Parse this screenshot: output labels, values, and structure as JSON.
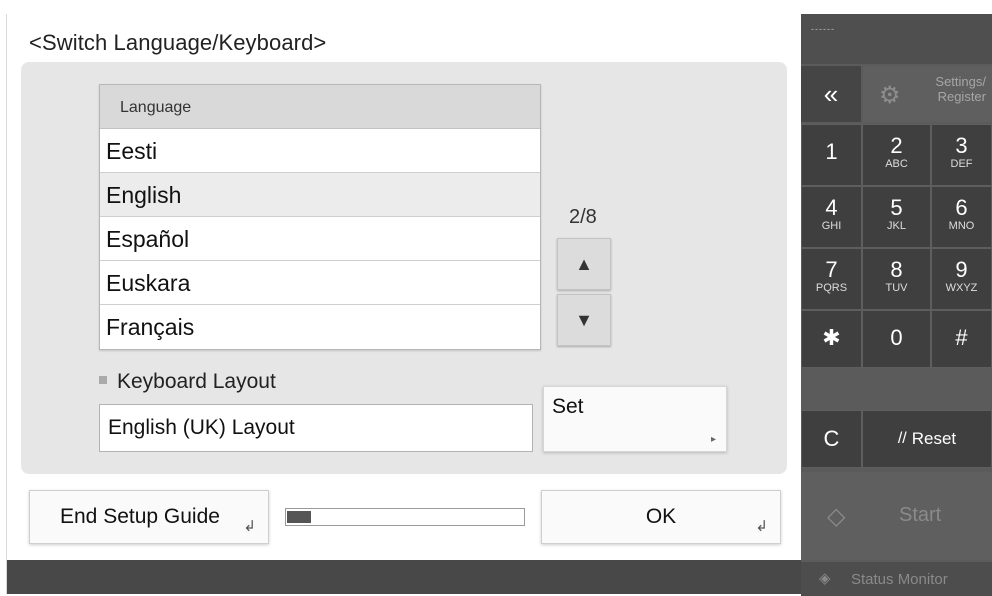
{
  "screen": {
    "title": "<Switch Language/Keyboard>"
  },
  "language_list": {
    "header": "Language",
    "items": [
      "Eesti",
      "English",
      "Español",
      "Euskara",
      "Français"
    ],
    "selected_index": 1,
    "page": "2/8"
  },
  "keyboard": {
    "label": "Keyboard Layout",
    "value": "English (UK) Layout",
    "set_label": "Set"
  },
  "footer": {
    "end_setup_label": "End Setup Guide",
    "ok_label": "OK",
    "progress_fraction": 0.1
  },
  "keypad": {
    "top_dots": "------",
    "back_glyph": "«",
    "settings_label": "Settings/ Register",
    "keys": [
      {
        "digit": "1",
        "letters": ""
      },
      {
        "digit": "2",
        "letters": "ABC"
      },
      {
        "digit": "3",
        "letters": "DEF"
      },
      {
        "digit": "4",
        "letters": "GHI"
      },
      {
        "digit": "5",
        "letters": "JKL"
      },
      {
        "digit": "6",
        "letters": "MNO"
      },
      {
        "digit": "7",
        "letters": "PQRS"
      },
      {
        "digit": "8",
        "letters": "TUV"
      },
      {
        "digit": "9",
        "letters": "WXYZ"
      },
      {
        "digit": "✱",
        "letters": ""
      },
      {
        "digit": "0",
        "letters": ""
      },
      {
        "digit": "#",
        "letters": ""
      }
    ],
    "clear_label": "C",
    "reset_label": "Reset",
    "start_label": "Start",
    "status_label": "Status Monitor"
  },
  "icons": {
    "up": "▲",
    "down": "▼",
    "gear": "⚙",
    "start": "◇",
    "status": "◈",
    "corner": "↲",
    "set_arrow": "▸",
    "reset": "//"
  }
}
